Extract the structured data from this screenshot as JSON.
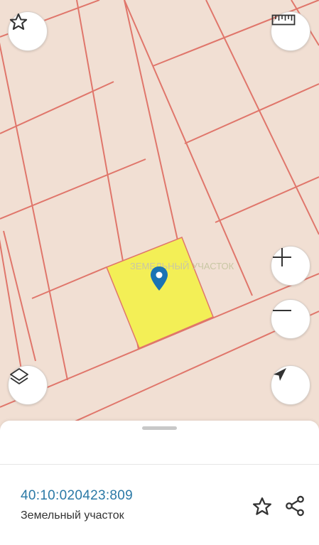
{
  "map": {
    "background_color": "#f1dfd3",
    "boundary_color": "#e0766b",
    "selected_parcel_color": "#f3ef56",
    "marker_color": "#1a73b4",
    "watermark": "ЗЕМЕЛЬНЫЙ УЧАСТОК"
  },
  "controls": {
    "favorite": {
      "icon": "star-outline-icon"
    },
    "ruler": {
      "icon": "ruler-icon"
    },
    "zoom_in": {
      "icon": "plus-icon"
    },
    "zoom_out": {
      "icon": "minus-icon"
    },
    "layers": {
      "icon": "layers-icon"
    },
    "locate": {
      "icon": "navigation-arrow-icon"
    }
  },
  "parcel": {
    "cadastral_number": "40:10:020423:809",
    "type": "Земельный участок"
  },
  "actions": {
    "favorite_icon": "star-outline-icon",
    "share_icon": "share-icon"
  }
}
